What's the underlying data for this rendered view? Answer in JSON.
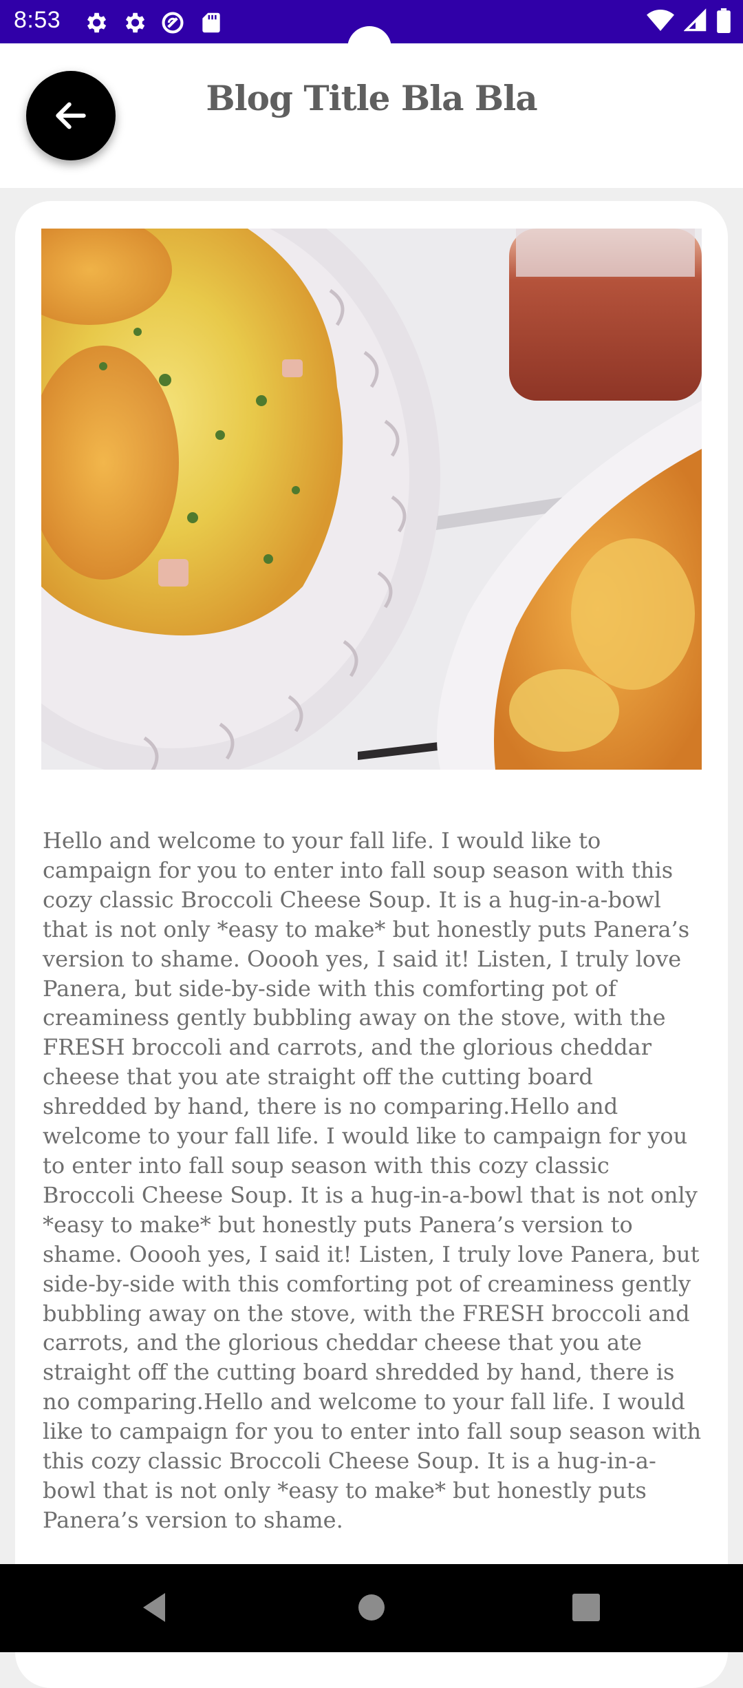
{
  "status_bar": {
    "time": "8:53",
    "icons": [
      "settings-icon",
      "settings-icon",
      "do-not-disturb-icon",
      "sd-card-icon"
    ],
    "right_icons": [
      "wifi-icon",
      "cell-signal-icon",
      "battery-icon"
    ],
    "color": "#3000a8"
  },
  "header": {
    "back_icon": "arrow-left-icon",
    "title": "Blog Title Bla Bla"
  },
  "article": {
    "image": "food-photo",
    "body": "Hello and welcome to your fall life.  I would like to campaign for you to enter into fall soup season with this cozy classic Broccoli Cheese Soup. It is a hug-in-a-bowl that is not only *easy to make* but honestly puts Panera’s version to shame. Ooooh yes, I said it! Listen, I truly love Panera, but side-by-side with this comforting pot of creaminess gently bubbling away on the stove, with the FRESH broccoli and carrots, and the glorious cheddar cheese that you ate straight off the cutting board shredded by hand, there is no comparing.Hello and welcome to your fall life.  I would like to campaign for you to enter into fall soup season with this cozy classic Broccoli Cheese Soup. It is a hug-in-a-bowl that is not only *easy to make* but honestly puts Panera’s version to shame. Ooooh yes, I said it! Listen, I truly love Panera, but side-by-side with this comforting pot of creaminess gently bubbling away on the stove, with the FRESH broccoli and carrots, and the glorious cheddar cheese that you ate straight off the cutting board shredded by hand, there is no comparing.Hello and welcome to your fall life.  I would like to campaign for you to enter into fall soup season with this cozy classic Broccoli Cheese Soup. It is a hug-in-a-bowl that is not only *easy to make* but honestly puts Panera’s version to shame."
  },
  "nav_bar": {
    "buttons": [
      "back-nav-icon",
      "home-nav-icon",
      "recents-nav-icon"
    ]
  }
}
